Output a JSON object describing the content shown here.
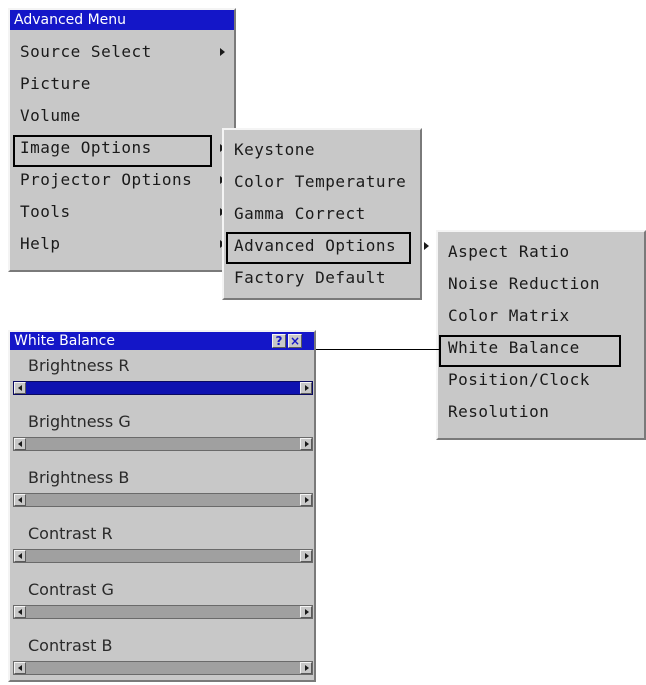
{
  "advanced_menu": {
    "title": "Advanced Menu",
    "items": [
      {
        "label": "Source Select",
        "submenu": true
      },
      {
        "label": "Picture",
        "submenu": false
      },
      {
        "label": "Volume",
        "submenu": false
      },
      {
        "label": "Image Options",
        "submenu": true,
        "selected": true
      },
      {
        "label": "Projector Options",
        "submenu": true
      },
      {
        "label": "Tools",
        "submenu": true
      },
      {
        "label": "Help",
        "submenu": true
      }
    ]
  },
  "image_options_menu": {
    "items": [
      {
        "label": "Keystone",
        "submenu": false
      },
      {
        "label": "Color Temperature",
        "submenu": false
      },
      {
        "label": "Gamma Correct",
        "submenu": false
      },
      {
        "label": "Advanced Options",
        "submenu": true,
        "selected": true
      },
      {
        "label": "Factory Default",
        "submenu": false
      }
    ]
  },
  "advanced_options_menu": {
    "items": [
      {
        "label": "Aspect Ratio"
      },
      {
        "label": "Noise Reduction"
      },
      {
        "label": "Color Matrix"
      },
      {
        "label": "White Balance",
        "selected": true
      },
      {
        "label": "Position/Clock"
      },
      {
        "label": "Resolution"
      }
    ]
  },
  "white_balance": {
    "title": "White Balance",
    "help_button": "?",
    "close_button": "×",
    "sliders": [
      {
        "label": "Brightness R",
        "active": true
      },
      {
        "label": "Brightness G",
        "active": false
      },
      {
        "label": "Brightness B",
        "active": false
      },
      {
        "label": "Contrast R",
        "active": false
      },
      {
        "label": "Contrast G",
        "active": false
      },
      {
        "label": "Contrast B",
        "active": false
      }
    ]
  },
  "colors": {
    "title_bar": "#1416c8",
    "panel": "#c8c8c8",
    "active_slider": "#0e12b0",
    "inactive_slider": "#a0a0a0"
  }
}
